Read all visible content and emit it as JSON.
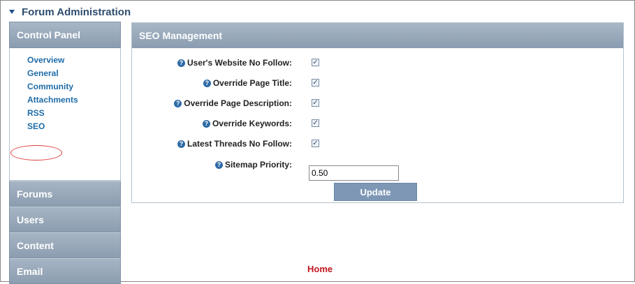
{
  "header": {
    "title": "Forum Administration"
  },
  "sidebar": {
    "control_panel_title": "Control Panel",
    "links": [
      {
        "label": "Overview"
      },
      {
        "label": "General"
      },
      {
        "label": "Community"
      },
      {
        "label": "Attachments"
      },
      {
        "label": "RSS"
      },
      {
        "label": "SEO"
      }
    ],
    "sections": [
      {
        "label": "Forums"
      },
      {
        "label": "Users"
      },
      {
        "label": "Content"
      },
      {
        "label": "Email"
      }
    ]
  },
  "seo": {
    "title": "SEO Management",
    "rows": [
      {
        "label": "User's Website No Follow:",
        "checked": true
      },
      {
        "label": "Override Page Title:",
        "checked": true
      },
      {
        "label": "Override Page Description:",
        "checked": true
      },
      {
        "label": "Override Keywords:",
        "checked": true
      },
      {
        "label": "Latest Threads No Follow:",
        "checked": true
      }
    ],
    "sitemap_label": "Sitemap Priority:",
    "sitemap_value": "0.50",
    "update_label": "Update"
  },
  "footer": {
    "home_label": "Home"
  },
  "colors": {
    "accent": "#8a9cb0",
    "link": "#1f6ca8",
    "home": "#c0161e",
    "highlight": "#e03a3a"
  }
}
